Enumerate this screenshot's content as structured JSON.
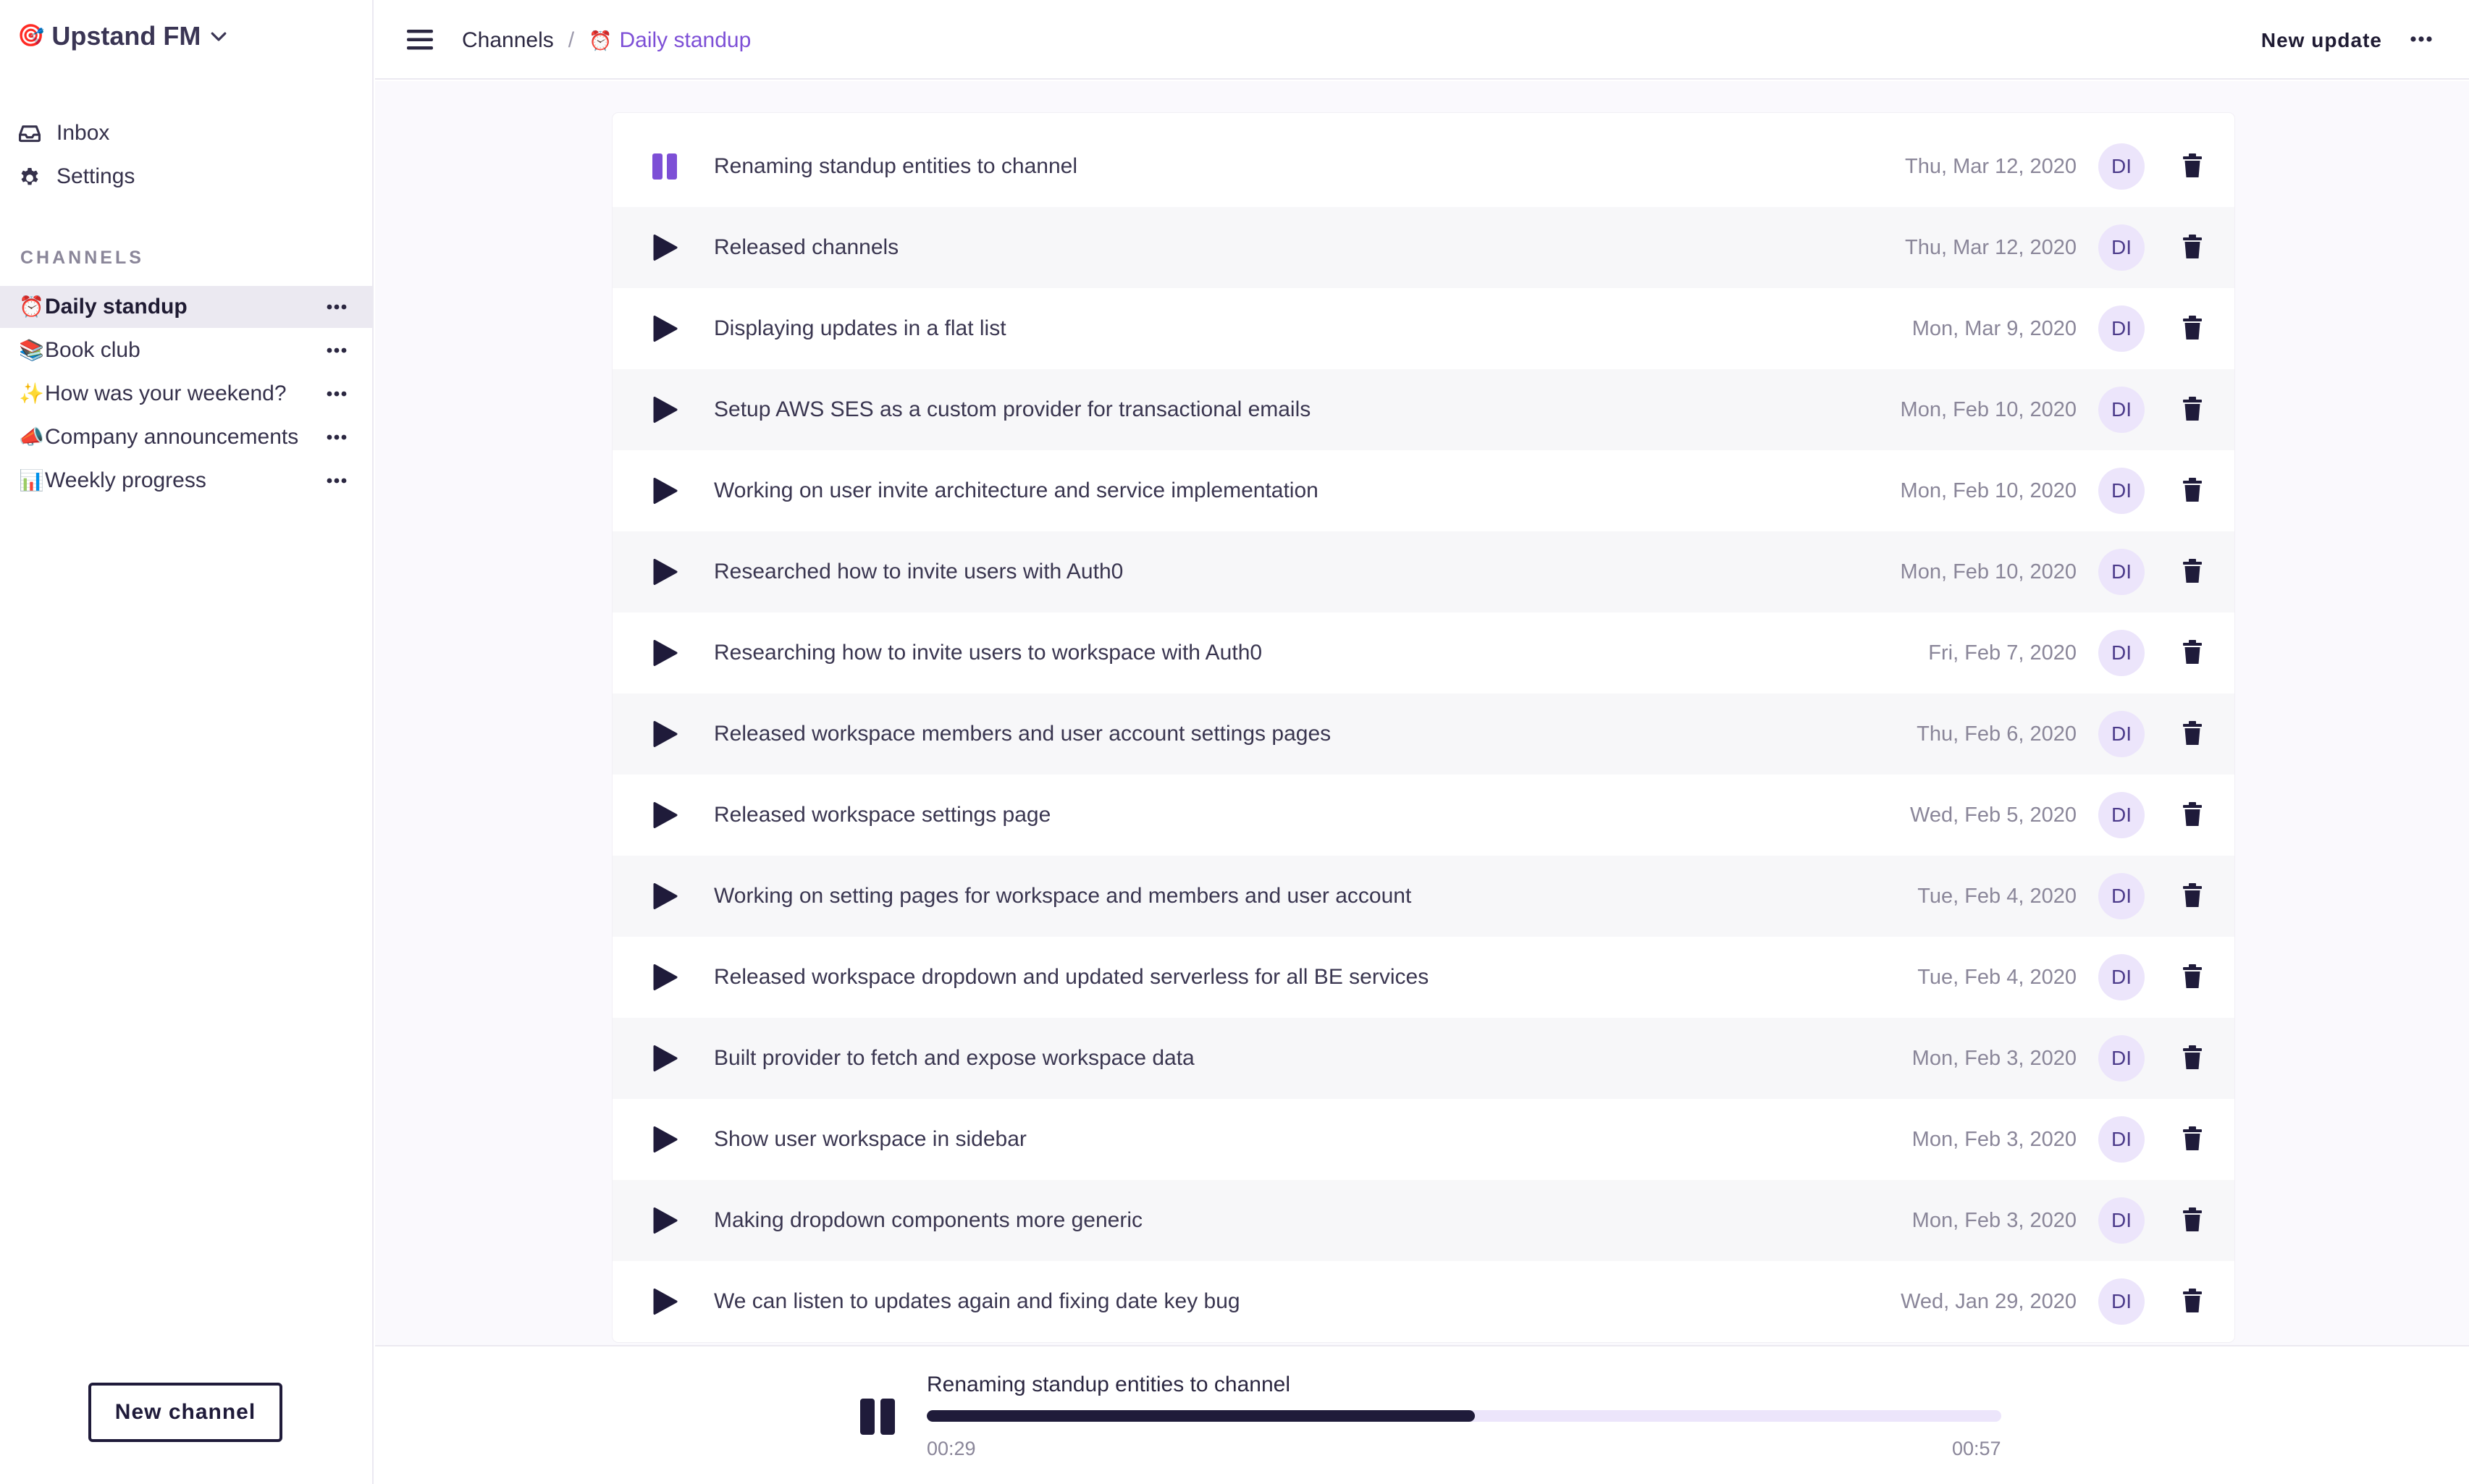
{
  "workspace": {
    "emoji": "🎯",
    "name": "Upstand FM"
  },
  "nav": [
    {
      "label": "Inbox",
      "icon": "inbox-icon"
    },
    {
      "label": "Settings",
      "icon": "gear-icon"
    }
  ],
  "channels_section": {
    "title": "CHANNELS"
  },
  "channels": [
    {
      "emoji": "⏰",
      "label": "Daily standup",
      "active": true
    },
    {
      "emoji": "📚",
      "label": "Book club",
      "active": false
    },
    {
      "emoji": "✨",
      "label": "How was your weekend?",
      "active": false
    },
    {
      "emoji": "📣",
      "label": "Company announcements",
      "active": false
    },
    {
      "emoji": "📊",
      "label": "Weekly progress",
      "active": false
    }
  ],
  "new_channel_label": "New channel",
  "breadcrumb": {
    "root": "Channels",
    "separator": "/",
    "current_emoji": "⏰",
    "current": "Daily standup"
  },
  "header": {
    "new_update_label": "New update"
  },
  "updates": [
    {
      "title": "Renaming standup entities to channel",
      "date": "Thu, Mar 12, 2020",
      "avatar": "DI",
      "playing": true
    },
    {
      "title": "Released channels",
      "date": "Thu, Mar 12, 2020",
      "avatar": "DI",
      "playing": false
    },
    {
      "title": "Displaying updates in a flat list",
      "date": "Mon, Mar 9, 2020",
      "avatar": "DI",
      "playing": false
    },
    {
      "title": "Setup AWS SES as a custom provider for transactional emails",
      "date": "Mon, Feb 10, 2020",
      "avatar": "DI",
      "playing": false
    },
    {
      "title": "Working on user invite architecture and service implementation",
      "date": "Mon, Feb 10, 2020",
      "avatar": "DI",
      "playing": false
    },
    {
      "title": "Researched how to invite users with Auth0",
      "date": "Mon, Feb 10, 2020",
      "avatar": "DI",
      "playing": false
    },
    {
      "title": "Researching how to invite users to workspace with Auth0",
      "date": "Fri, Feb 7, 2020",
      "avatar": "DI",
      "playing": false
    },
    {
      "title": "Released workspace members and user account settings pages",
      "date": "Thu, Feb 6, 2020",
      "avatar": "DI",
      "playing": false
    },
    {
      "title": "Released workspace settings page",
      "date": "Wed, Feb 5, 2020",
      "avatar": "DI",
      "playing": false
    },
    {
      "title": "Working on setting pages for workspace and members and user account",
      "date": "Tue, Feb 4, 2020",
      "avatar": "DI",
      "playing": false
    },
    {
      "title": "Released workspace dropdown and updated serverless for all BE services",
      "date": "Tue, Feb 4, 2020",
      "avatar": "DI",
      "playing": false
    },
    {
      "title": "Built provider to fetch and expose workspace data",
      "date": "Mon, Feb 3, 2020",
      "avatar": "DI",
      "playing": false
    },
    {
      "title": "Show user workspace in sidebar",
      "date": "Mon, Feb 3, 2020",
      "avatar": "DI",
      "playing": false
    },
    {
      "title": "Making dropdown components more generic",
      "date": "Mon, Feb 3, 2020",
      "avatar": "DI",
      "playing": false
    },
    {
      "title": "We can listen to updates again and fixing date key bug",
      "date": "Wed, Jan 29, 2020",
      "avatar": "DI",
      "playing": false
    }
  ],
  "player": {
    "title": "Renaming standup entities to channel",
    "current_time": "00:29",
    "total_time": "00:57",
    "progress": 0.51
  },
  "colors": {
    "accent": "#7d4fd6",
    "dark": "#1f1b3a",
    "avatar_bg": "#ece5fb",
    "active_bg": "#ebe9f1"
  }
}
